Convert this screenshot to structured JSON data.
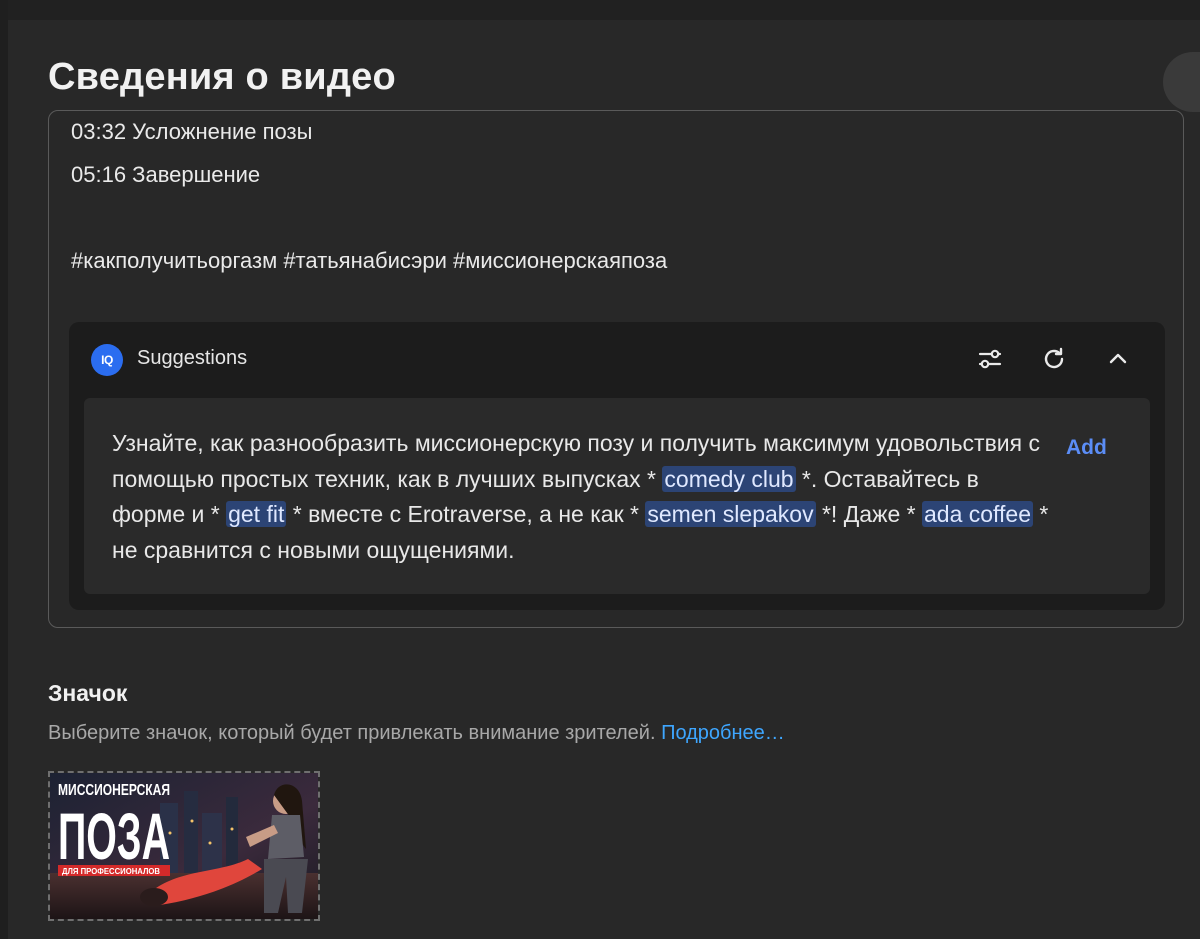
{
  "page": {
    "title": "Сведения о видео"
  },
  "description": {
    "clipped_line": "03:32 Усложнение позы",
    "line_2": "05:16 Завершение",
    "hashtags": "#какполучитьоргазм #татьянабисэри #миссионерскаяпоза"
  },
  "suggestions": {
    "logo_text": "IQ",
    "title": "Suggestions",
    "add_label": "Add",
    "text_parts": {
      "p1": "Узнайте, как разнообразить миссионерскую позу и получить максимум удовольствия с помощью простых техник, как в лучших выпусках * ",
      "h1": "comedy club",
      "p2": " *. Оставайтесь в форме и * ",
      "h2": "get fit",
      "p3": " * вместе с Erotraverse, а не как * ",
      "h3": "semen slepakov",
      "p4": " *! Даже * ",
      "h4": "ada coffee",
      "p5": " * не сравнится с новыми ощущениями."
    },
    "icons": [
      "tune-icon",
      "refresh-icon",
      "chevron-up-icon"
    ]
  },
  "thumbnail_section": {
    "title": "Значок",
    "help_text": "Выберите значок, который будет привлекать внимание зрителей. ",
    "learn_more": "Подробнее…",
    "thumbnail": {
      "line1": "МИССИОНЕРСКАЯ",
      "line2": "ПОЗА",
      "badge": "ДЛЯ ПРОФЕССИОНАЛОВ"
    }
  },
  "colors": {
    "background": "#282828",
    "suggestions_panel": "#1c1c1c",
    "suggestion_body": "#2a2a2a",
    "highlight": "#2c4475",
    "link": "#3ea6ff",
    "add": "#5b8df6",
    "thumbnail_badge": "#d42a2a"
  }
}
